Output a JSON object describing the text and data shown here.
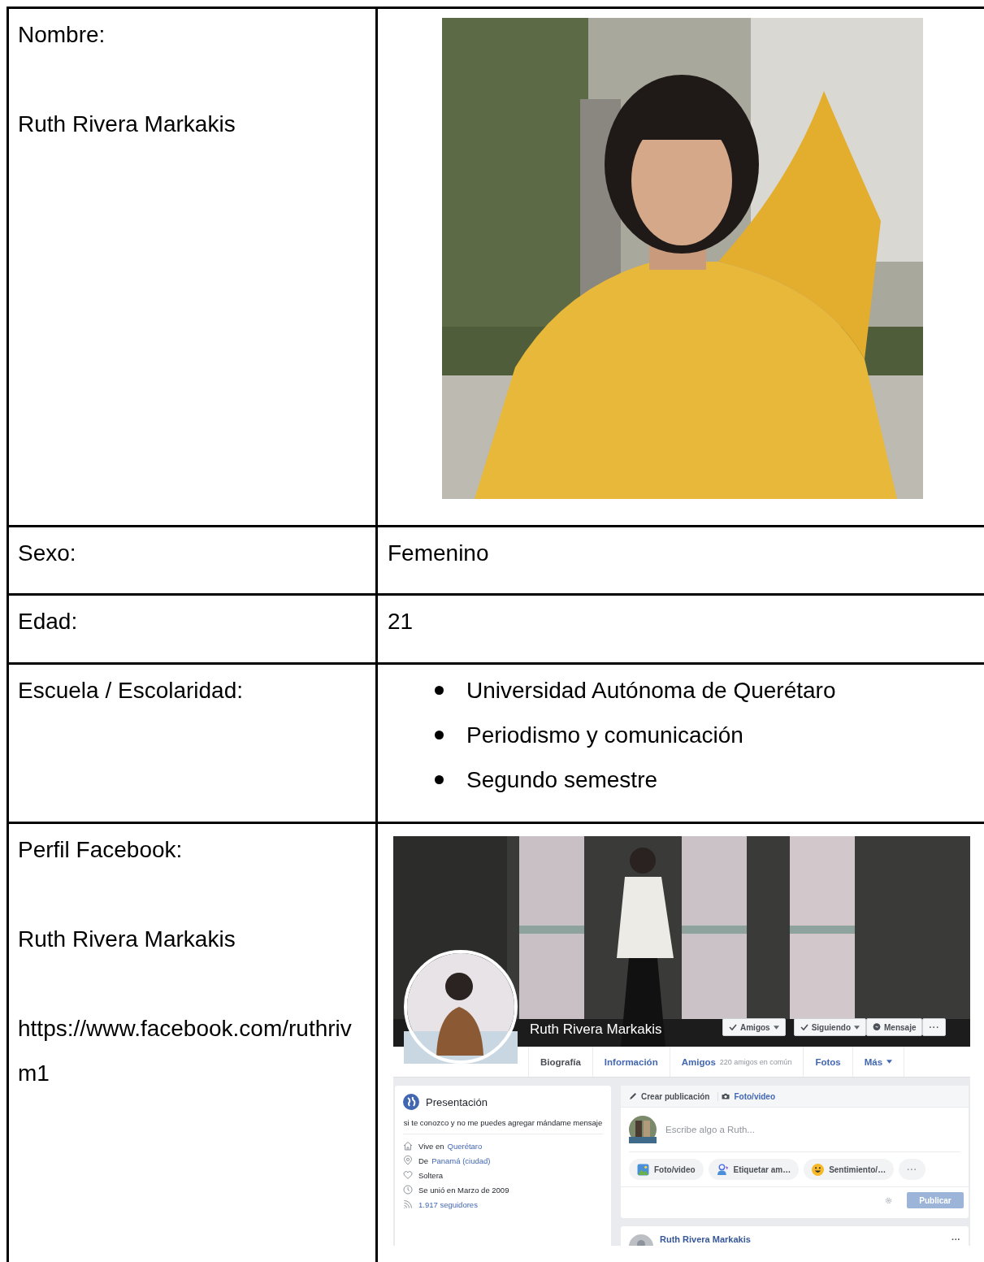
{
  "table": {
    "rows": [
      {
        "label_lines": [
          "Nombre:",
          "Ruth Rivera Markakis"
        ],
        "content": {
          "kind": "picture"
        }
      },
      {
        "label_lines": [
          "Sexo:"
        ],
        "content": {
          "kind": "text",
          "text": "Femenino"
        }
      },
      {
        "label_lines": [
          "Edad:"
        ],
        "content": {
          "kind": "text",
          "text": "21"
        }
      },
      {
        "label_lines": [
          "Escuela / Escolaridad:"
        ],
        "content": {
          "kind": "bullets",
          "items": [
            "Universidad Autónoma de Querétaro",
            "Periodismo y comunicación",
            "Segundo semestre"
          ]
        }
      },
      {
        "label_lines": [
          "Perfil Facebook:",
          "Ruth Rivera Markakis",
          "https://www.facebook.com/ruthrivm1"
        ],
        "content": {
          "kind": "facebook"
        }
      }
    ]
  },
  "facebook": {
    "profile_name": "Ruth Rivera Markakis",
    "actions": [
      {
        "kind": "check",
        "label": "Amigos",
        "caret": true
      },
      {
        "kind": "check",
        "label": "Siguiendo",
        "caret": true
      },
      {
        "kind": "messenger",
        "label": "Mensaje",
        "caret": false
      },
      {
        "kind": "more",
        "label": "···",
        "caret": false
      }
    ],
    "tabs": [
      {
        "label": "Biografía",
        "selected": true,
        "caret": false
      },
      {
        "label": "Información",
        "selected": false,
        "caret": false
      },
      {
        "label": "Amigos",
        "note": "220 amigos en común",
        "selected": false,
        "caret": false
      },
      {
        "label": "Fotos",
        "selected": false,
        "caret": false
      },
      {
        "label": "Más",
        "selected": false,
        "caret": true
      }
    ],
    "intro": {
      "title": "Presentación",
      "bio": "si te conozco y no me puedes agregar mándame mensaje",
      "details": [
        {
          "kind": "home",
          "text": "Vive en",
          "link": "Querétaro"
        },
        {
          "kind": "pin",
          "text": "De",
          "link": "Panamá (ciudad)"
        },
        {
          "kind": "heart",
          "text": "Soltera"
        },
        {
          "kind": "clock",
          "text": "Se unió en Marzo de 2009"
        },
        {
          "kind": "feed",
          "link": "1.917 seguidores"
        }
      ]
    },
    "composer": {
      "tabs": [
        {
          "kind": "pencil",
          "label": "Crear publicación",
          "selected": true
        },
        {
          "kind": "camera",
          "label": "Foto/video",
          "selected": false
        }
      ],
      "placeholder": "Escribe algo a Ruth...",
      "actions": [
        {
          "label": "Foto/video"
        },
        {
          "kind": "tag",
          "label": "Etiquetar am…"
        },
        {
          "kind": "feeling",
          "label": "Sentimiento/…"
        },
        {
          "kind": "more",
          "label": "···"
        }
      ],
      "publish": {
        "label": "Publicar",
        "disabled": true
      }
    },
    "post": {
      "author": "Ruth Rivera Markakis",
      "more": "···"
    }
  }
}
